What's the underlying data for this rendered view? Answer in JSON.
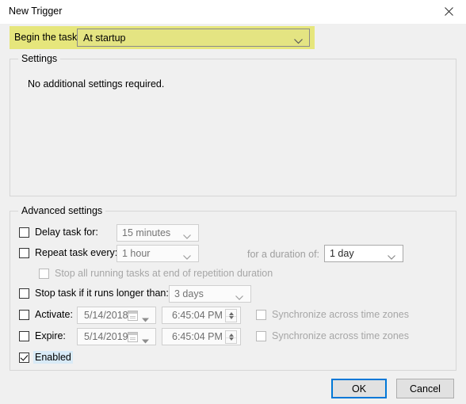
{
  "window": {
    "title": "New Trigger",
    "close_icon": "close-icon"
  },
  "begin_task": {
    "label": "Begin the task:",
    "value": "At startup",
    "highlight_color": "#e6e67c",
    "options": [
      "At startup"
    ]
  },
  "settings": {
    "group_title": "Settings",
    "note": "No additional settings required."
  },
  "advanced": {
    "group_title": "Advanced settings",
    "delay_task": {
      "label": "Delay task for:",
      "checked": false,
      "value": "15 minutes",
      "enabled": false
    },
    "repeat_task": {
      "label": "Repeat task every:",
      "checked": false,
      "value": "1 hour",
      "enabled": false
    },
    "duration": {
      "label": "for a duration of:",
      "value": "1 day",
      "enabled": false
    },
    "stop_all_running": {
      "label": "Stop all running tasks at end of repetition duration",
      "checked": false,
      "enabled": false
    },
    "stop_task_longer": {
      "label": "Stop task if it runs longer than:",
      "checked": false,
      "value": "3 days",
      "enabled": false
    },
    "activate": {
      "label": "Activate:",
      "checked": false,
      "date": "5/14/2018",
      "time": "6:45:04 PM",
      "sync_label": "Synchronize across time zones",
      "sync_checked": false
    },
    "expire": {
      "label": "Expire:",
      "checked": false,
      "date": "5/14/2019",
      "time": "6:45:04 PM",
      "sync_label": "Synchronize across time zones",
      "sync_checked": false
    },
    "enabled": {
      "label": "Enabled",
      "checked": true
    }
  },
  "footer": {
    "ok_label": "OK",
    "cancel_label": "Cancel",
    "default_button_color": "#0078d7"
  }
}
